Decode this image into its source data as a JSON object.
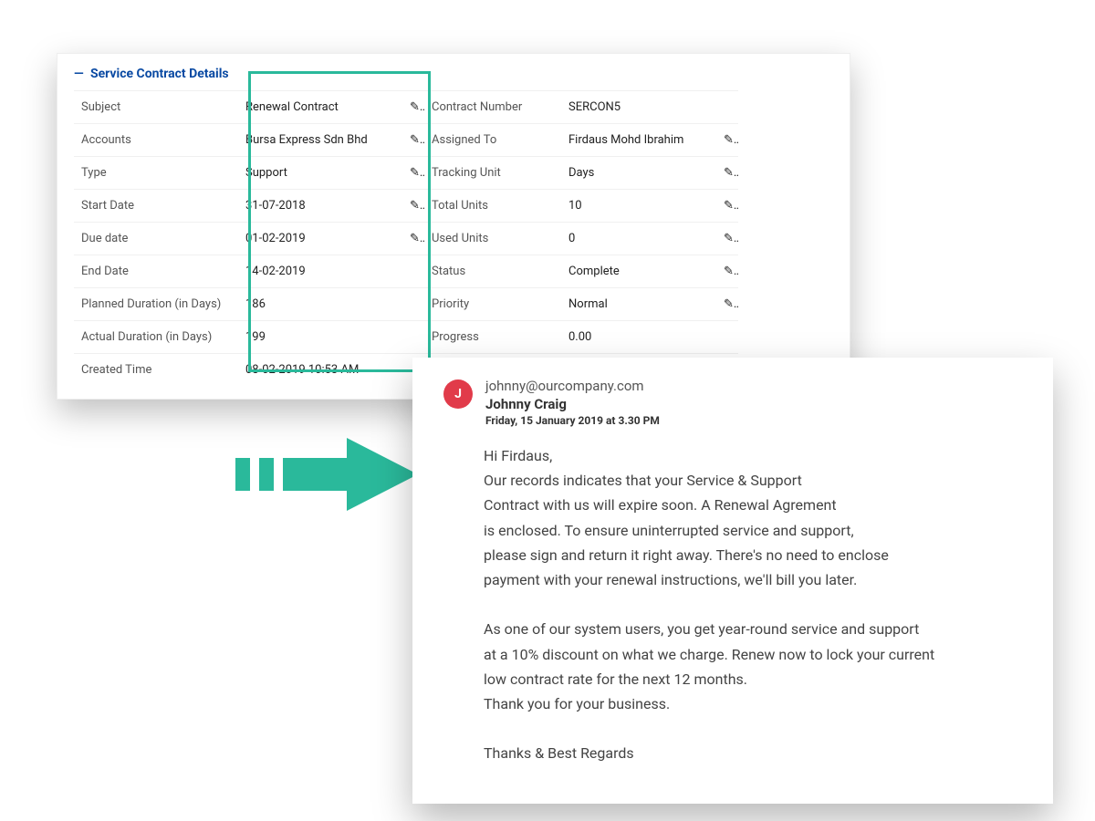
{
  "section": {
    "title": "Service Contract Details",
    "toggle_glyph": "—"
  },
  "left_fields": [
    {
      "label": "Subject",
      "value": "Renewal Contract",
      "editable": true
    },
    {
      "label": "Accounts",
      "value": "Bursa Express Sdn Bhd",
      "editable": true
    },
    {
      "label": "Type",
      "value": "Support",
      "editable": true
    },
    {
      "label": "Start Date",
      "value": "31-07-2018",
      "editable": true
    },
    {
      "label": "Due date",
      "value": "01-02-2019",
      "editable": true
    },
    {
      "label": "End Date",
      "value": "14-02-2019",
      "editable": false
    },
    {
      "label": "Planned Duration (in Days)",
      "value": "186",
      "editable": false
    },
    {
      "label": "Actual Duration (in Days)",
      "value": "199",
      "editable": false
    },
    {
      "label": "Created Time",
      "value": "08-02-2019 10:53 AM",
      "editable": false
    }
  ],
  "right_fields": [
    {
      "label": "Contract Number",
      "value": "SERCON5",
      "editable": false
    },
    {
      "label": "Assigned To",
      "value": "Firdaus Mohd Ibrahim",
      "editable": true
    },
    {
      "label": "Tracking Unit",
      "value": "Days",
      "editable": true
    },
    {
      "label": "Total Units",
      "value": "10",
      "editable": true
    },
    {
      "label": "Used Units",
      "value": "0",
      "editable": true
    },
    {
      "label": "Status",
      "value": "Complete",
      "editable": true
    },
    {
      "label": "Priority",
      "value": "Normal",
      "editable": true
    },
    {
      "label": "Progress",
      "value": "0.00",
      "editable": false
    },
    {
      "label": "",
      "value": "",
      "editable": false
    }
  ],
  "email": {
    "avatar_initial": "J",
    "address": "johnny@ourcompany.com",
    "name": "Johnny Craig",
    "date": "Friday, 15 January 2019 at 3.30 PM",
    "body": "Hi Firdaus,\nOur records indicates that your Service & Support\nContract with us will expire soon. A Renewal Agrement\nis enclosed. To ensure uninterrupted service and support,\nplease sign and return it right away. There's no need to enclose\npayment with your renewal instructions, we'll bill you later.\n\nAs one of our system users, you get year-round service and support\nat a 10% discount on what we charge. Renew now to lock your current\nlow contract rate for the next 12 months.\nThank you for your business.\n\nThanks & Best Regards"
  },
  "colors": {
    "accent_teal": "#2ab99b",
    "link_blue": "#0a4aa3",
    "avatar_red": "#e13b4a"
  },
  "icons": {
    "edit": "✎"
  }
}
